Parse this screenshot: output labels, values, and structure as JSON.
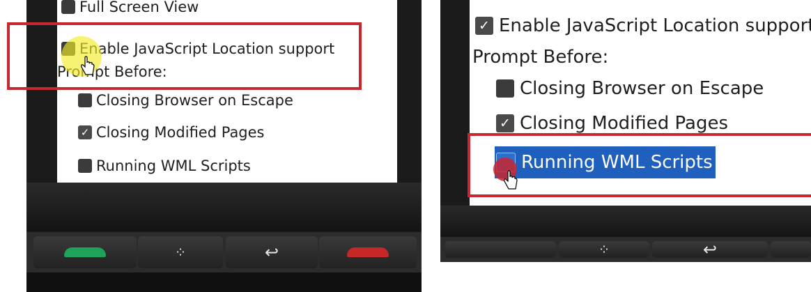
{
  "left_panel": {
    "top_item": "Full Screen View",
    "enable_js_location": "Enable JavaScript Location support",
    "prompt_before": "Prompt Before:",
    "closing_browser": "Closing Browser on Escape",
    "closing_modified": "Closing Modified Pages",
    "running_wml": "Running WML Scripts"
  },
  "right_panel": {
    "enable_js_location": "Enable JavaScript Location support",
    "prompt_before": "Prompt Before:",
    "closing_browser": "Closing Browser on Escape",
    "closing_modified": "Closing Modified Pages",
    "running_wml": "Running WML Scripts"
  },
  "checkbox_states": {
    "left": {
      "full_screen_view": false,
      "enable_js_location": false,
      "closing_browser": false,
      "closing_modified": true,
      "running_wml": false
    },
    "right": {
      "enable_js_location": true,
      "closing_browser": false,
      "closing_modified": true,
      "running_wml": "selected"
    }
  },
  "colors": {
    "annotation_red": "#c8272f",
    "selection_blue": "#1f5fbd",
    "call_green": "#1fa35a",
    "end_red": "#c62828",
    "click_highlight_yellow": "#f2ea2a"
  },
  "icons": {
    "menu_key": "blackberry-logo-icon",
    "back_key": "back-arrow-icon",
    "call_key": "phone-call-icon",
    "end_key": "phone-end-icon",
    "pointer": "hand-cursor-icon"
  },
  "symbols": {
    "check": "✓",
    "back": "↩",
    "bb_logo": "⁘"
  }
}
